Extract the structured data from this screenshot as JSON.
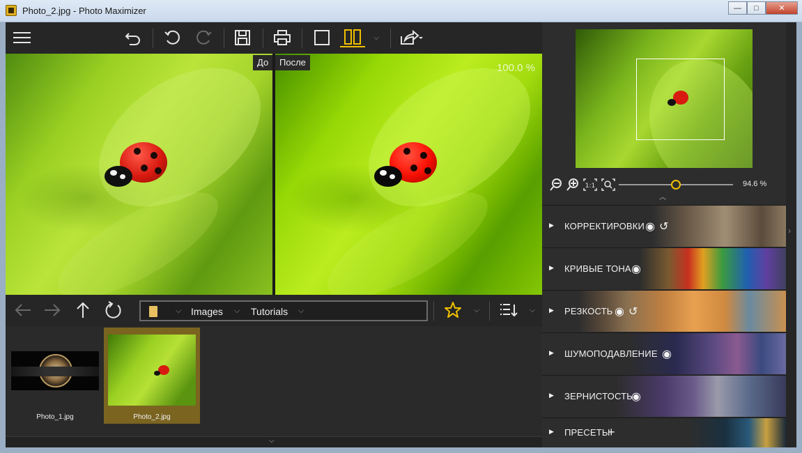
{
  "window": {
    "title": "Photo_2.jpg - Photo Maximizer",
    "minimize": "—",
    "maximize": "□",
    "close": "✕"
  },
  "toolbar": {
    "menu": "menu-icon",
    "undo": "undo-icon",
    "redo": "redo-icon"
  },
  "compare": {
    "before_label": "До",
    "after_label": "После",
    "zoom": "100.0 %"
  },
  "breadcrumb": {
    "items": [
      "Images",
      "Tutorials"
    ]
  },
  "thumbnails": [
    {
      "label": "Photo_1.jpg",
      "selected": false
    },
    {
      "label": "Photo_2.jpg",
      "selected": true
    }
  ],
  "navigator": {
    "zoom_value": "94.6 %",
    "zoom_fraction": 0.5
  },
  "sections": [
    {
      "label": "КОРРЕКТИРОВКИ",
      "icons": [
        "eye-icon",
        "reset-icon"
      ]
    },
    {
      "label": "КРИВЫЕ ТОНА",
      "icons": [
        "eye-icon"
      ]
    },
    {
      "label": "РЕЗКОСТЬ",
      "icons": [
        "eye-icon",
        "reset-icon"
      ]
    },
    {
      "label": "ШУМОПОДАВЛЕНИЕ",
      "icons": [
        "eye-icon"
      ]
    },
    {
      "label": "ЗЕРНИСТОСТЬ",
      "icons": [
        "eye-icon"
      ]
    },
    {
      "label": "ПРЕСЕТЫ",
      "icons": [
        "plus-icon"
      ]
    }
  ],
  "colors": {
    "accent": "#f0c000",
    "selected_thumb": "#7a6420"
  }
}
